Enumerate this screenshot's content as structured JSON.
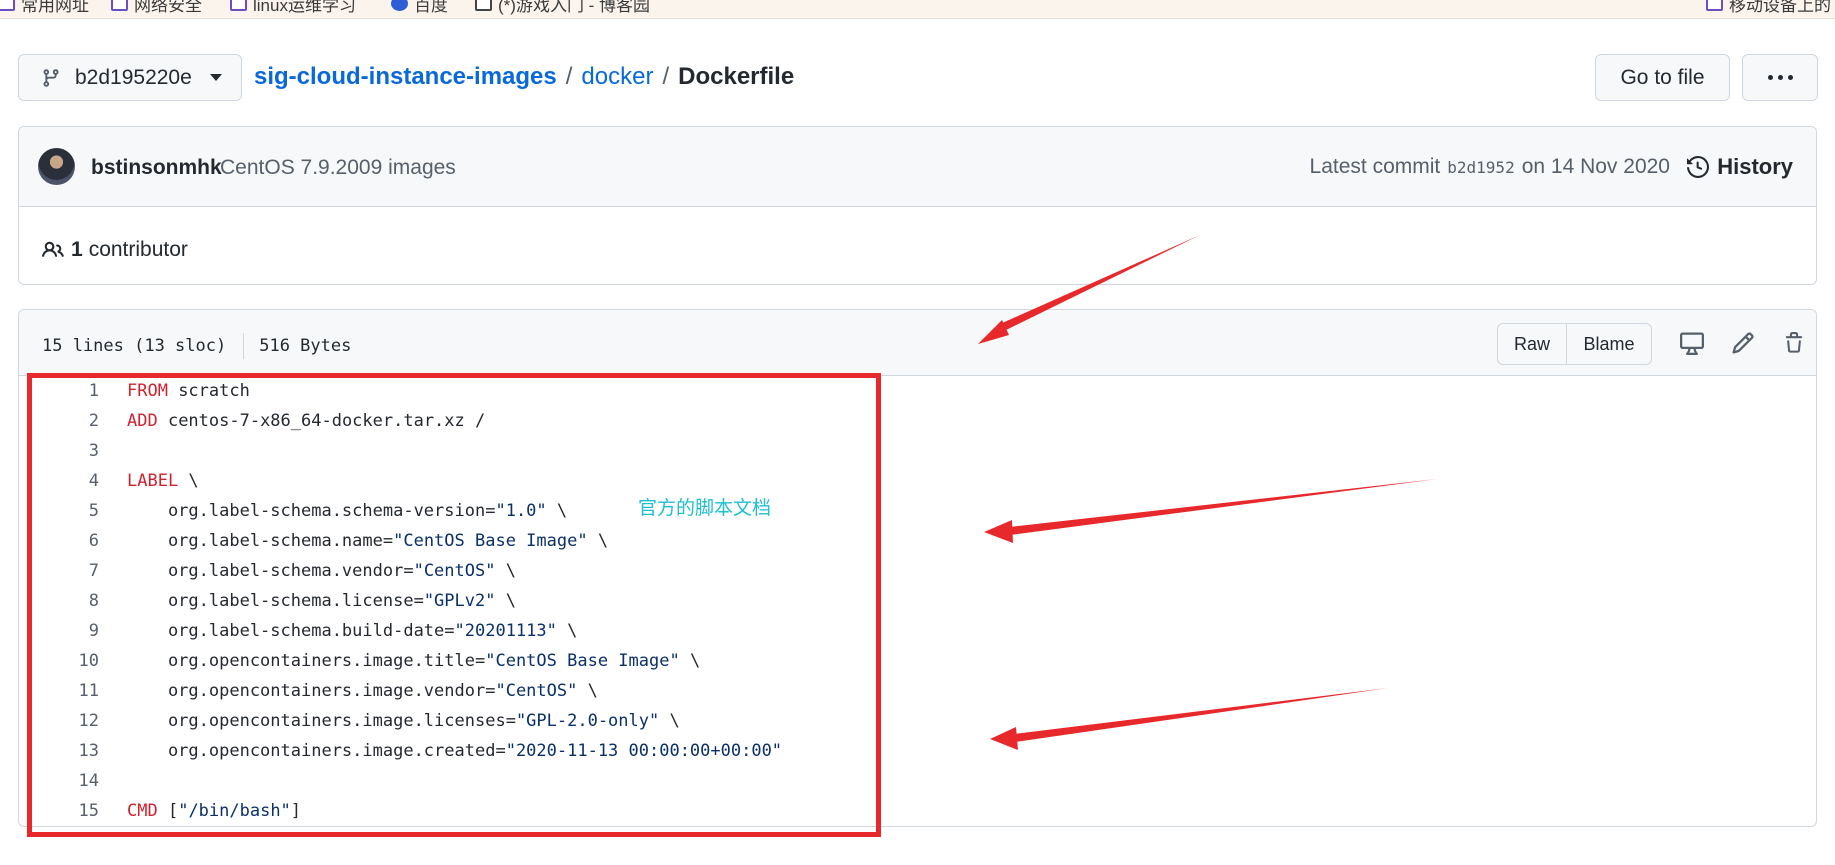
{
  "bookmarks": {
    "items": [
      {
        "label": "常用网址",
        "icon": "folder-icon"
      },
      {
        "label": "网络安全",
        "icon": "folder-icon"
      },
      {
        "label": "linux运维学习",
        "icon": "folder-icon"
      },
      {
        "label": "百度",
        "icon": "baidu-icon"
      },
      {
        "label": "(*)游戏入门 - 博客园",
        "icon": "page-icon"
      },
      {
        "label": "移动设备上的",
        "icon": "mobile-folder-icon"
      }
    ]
  },
  "nav": {
    "branch": "b2d195220e",
    "breadcrumb": {
      "repo": "sig-cloud-instance-images",
      "sep1": "/",
      "folder": "docker",
      "sep2": "/",
      "file": "Dockerfile"
    },
    "goto_label": "Go to file"
  },
  "commit": {
    "author": "bstinsonmhk",
    "message": "CentOS 7.9.2009 images",
    "latest_label": "Latest commit",
    "sha": "b2d1952",
    "date": "on 14 Nov 2020",
    "history_label": "History",
    "contributors_count": "1",
    "contributors_label": "contributor"
  },
  "file": {
    "lines_info": "15 lines (13 sloc)",
    "size": "516 Bytes",
    "raw_label": "Raw",
    "blame_label": "Blame",
    "code": [
      {
        "n": "1",
        "kw": "FROM",
        "rest": " scratch",
        "str": "",
        "tail": ""
      },
      {
        "n": "2",
        "kw": "ADD",
        "rest": " centos-7-x86_64-docker.tar.xz /",
        "str": "",
        "tail": ""
      },
      {
        "n": "3",
        "kw": "",
        "rest": "",
        "str": "",
        "tail": ""
      },
      {
        "n": "4",
        "kw": "LABEL",
        "rest": " \\",
        "str": "",
        "tail": ""
      },
      {
        "n": "5",
        "kw": "",
        "rest": "    org.label-schema.schema-version=",
        "str": "\"1.0\"",
        "tail": " \\"
      },
      {
        "n": "6",
        "kw": "",
        "rest": "    org.label-schema.name=",
        "str": "\"CentOS Base Image\"",
        "tail": " \\"
      },
      {
        "n": "7",
        "kw": "",
        "rest": "    org.label-schema.vendor=",
        "str": "\"CentOS\"",
        "tail": " \\"
      },
      {
        "n": "8",
        "kw": "",
        "rest": "    org.label-schema.license=",
        "str": "\"GPLv2\"",
        "tail": " \\"
      },
      {
        "n": "9",
        "kw": "",
        "rest": "    org.label-schema.build-date=",
        "str": "\"20201113\"",
        "tail": " \\"
      },
      {
        "n": "10",
        "kw": "",
        "rest": "    org.opencontainers.image.title=",
        "str": "\"CentOS Base Image\"",
        "tail": " \\"
      },
      {
        "n": "11",
        "kw": "",
        "rest": "    org.opencontainers.image.vendor=",
        "str": "\"CentOS\"",
        "tail": " \\"
      },
      {
        "n": "12",
        "kw": "",
        "rest": "    org.opencontainers.image.licenses=",
        "str": "\"GPL-2.0-only\"",
        "tail": " \\"
      },
      {
        "n": "13",
        "kw": "",
        "rest": "    org.opencontainers.image.created=",
        "str": "\"2020-11-13 00:00:00+00:00\"",
        "tail": ""
      },
      {
        "n": "14",
        "kw": "",
        "rest": "",
        "str": "",
        "tail": ""
      },
      {
        "n": "15",
        "kw": "CMD",
        "rest": " [",
        "str": "\"/bin/bash\"",
        "tail": "]"
      }
    ]
  },
  "annotation": {
    "note": "官方的脚本文档",
    "color": "#e8292c"
  },
  "colors": {
    "link": "#0969da",
    "keyword": "#cf222e",
    "string": "#0a3069"
  }
}
